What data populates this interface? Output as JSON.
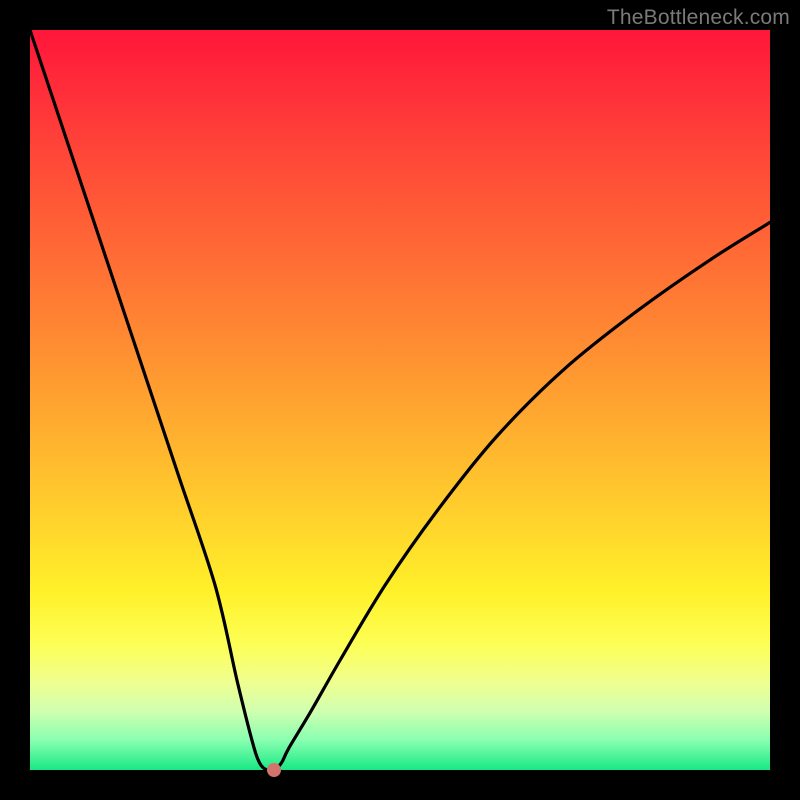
{
  "watermark": "TheBottleneck.com",
  "chart_data": {
    "type": "line",
    "title": "",
    "xlabel": "",
    "ylabel": "",
    "xlim": [
      0,
      100
    ],
    "ylim": [
      0,
      100
    ],
    "grid": false,
    "legend": false,
    "series": [
      {
        "name": "bottleneck-curve",
        "x": [
          0,
          5,
          10,
          15,
          20,
          25,
          28,
          30,
          31,
          32,
          33,
          34,
          35,
          38,
          42,
          48,
          55,
          63,
          72,
          82,
          92,
          100
        ],
        "values": [
          100,
          85,
          70,
          55,
          40,
          25,
          12,
          4,
          1,
          0,
          0,
          1,
          3,
          8,
          15,
          25,
          35,
          45,
          54,
          62,
          69,
          74
        ]
      }
    ],
    "marker": {
      "x": 33,
      "y": 0,
      "color": "#d2746b"
    },
    "gradient_stops": [
      {
        "pos": 0,
        "color": "#ff163a"
      },
      {
        "pos": 50,
        "color": "#ffae2f"
      },
      {
        "pos": 80,
        "color": "#fff12a"
      },
      {
        "pos": 100,
        "color": "#18e884"
      }
    ]
  }
}
